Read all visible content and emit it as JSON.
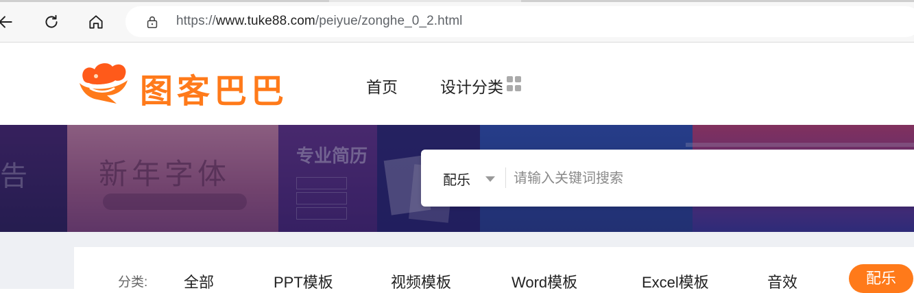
{
  "browser": {
    "url_prefix": "https://",
    "url_host": "www.tuke88.com",
    "url_path": "/peiyue/zonghe_0_2.html"
  },
  "site": {
    "logo_text": "图客巴巴",
    "nav": [
      {
        "label": "首页"
      },
      {
        "label": "设计分类"
      }
    ]
  },
  "banner": {
    "texts": [
      "告",
      "新年字体",
      "专业简历"
    ]
  },
  "search": {
    "category": "配乐",
    "placeholder": "请输入关键词搜索"
  },
  "filters": {
    "label": "分类:",
    "items": [
      "全部",
      "PPT模板",
      "视频模板",
      "Word模板",
      "Excel模板",
      "音效",
      "配乐"
    ],
    "active": "配乐"
  },
  "colors": {
    "brand_orange": "#ff7a1a",
    "page_bg": "#eef0f4"
  }
}
